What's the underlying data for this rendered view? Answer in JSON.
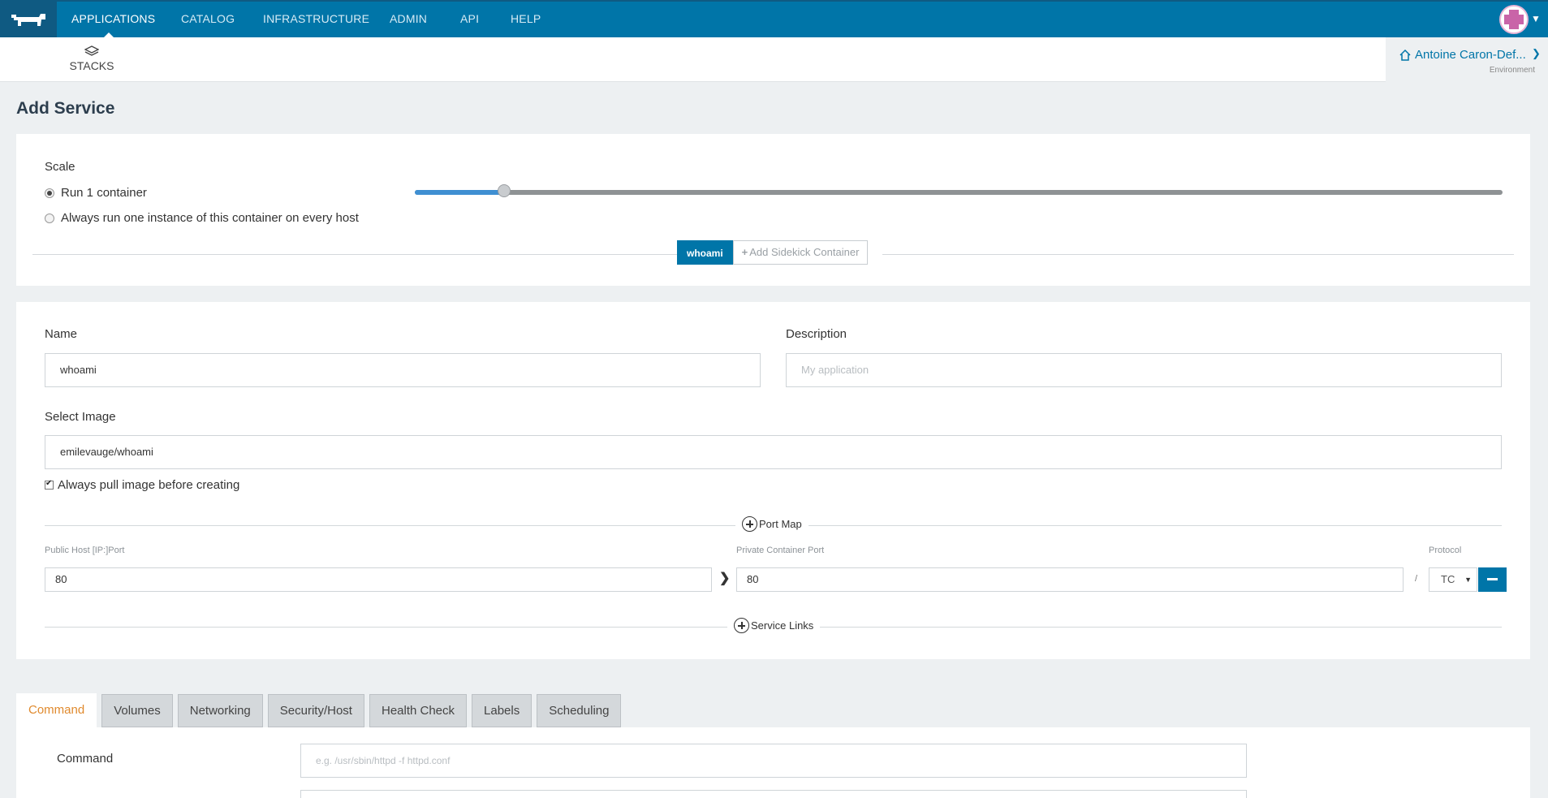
{
  "app": {
    "nav": {
      "items": [
        "APPLICATIONS",
        "CATALOG",
        "INFRASTRUCTURE",
        "ADMIN",
        "API",
        "HELP"
      ],
      "active": "APPLICATIONS"
    },
    "subnav": {
      "stacks_label": "STACKS"
    },
    "environment": {
      "name": "Antoine Caron-Def...",
      "label": "Environment"
    }
  },
  "page": {
    "title": "Add Service"
  },
  "scale": {
    "label": "Scale",
    "options": [
      "Run 1 container",
      "Always run one instance of this container on every host"
    ],
    "selected": "Run 1 container",
    "slider_value_fraction": 0.082
  },
  "containers": {
    "active_tab": "whoami",
    "add_sidekick": "Add Sidekick Container"
  },
  "form": {
    "name_label": "Name",
    "name_value": "whoami",
    "description_label": "Description",
    "description_placeholder": "My application",
    "image_label": "Select Image",
    "image_value": "emilevauge/whoami",
    "always_pull_label": "Always pull image before creating",
    "always_pull_checked": true
  },
  "ports": {
    "section_label": "Port Map",
    "public_label": "Public Host [IP:]Port",
    "private_label": "Private Container Port",
    "protocol_label": "Protocol",
    "separator": "/",
    "rows": [
      {
        "public": "80",
        "private": "80",
        "protocol": "TC"
      }
    ]
  },
  "links": {
    "section_label": "Service Links"
  },
  "tabs": {
    "items": [
      "Command",
      "Volumes",
      "Networking",
      "Security/Host",
      "Health Check",
      "Labels",
      "Scheduling"
    ],
    "active": "Command"
  },
  "command": {
    "label": "Command",
    "placeholder": "e.g. /usr/sbin/httpd -f httpd.conf"
  },
  "colors": {
    "brand": "#0075a8",
    "brand_dark": "#0f5a82",
    "active_tab": "#e08a2e",
    "slider": "#3f8fd2"
  }
}
